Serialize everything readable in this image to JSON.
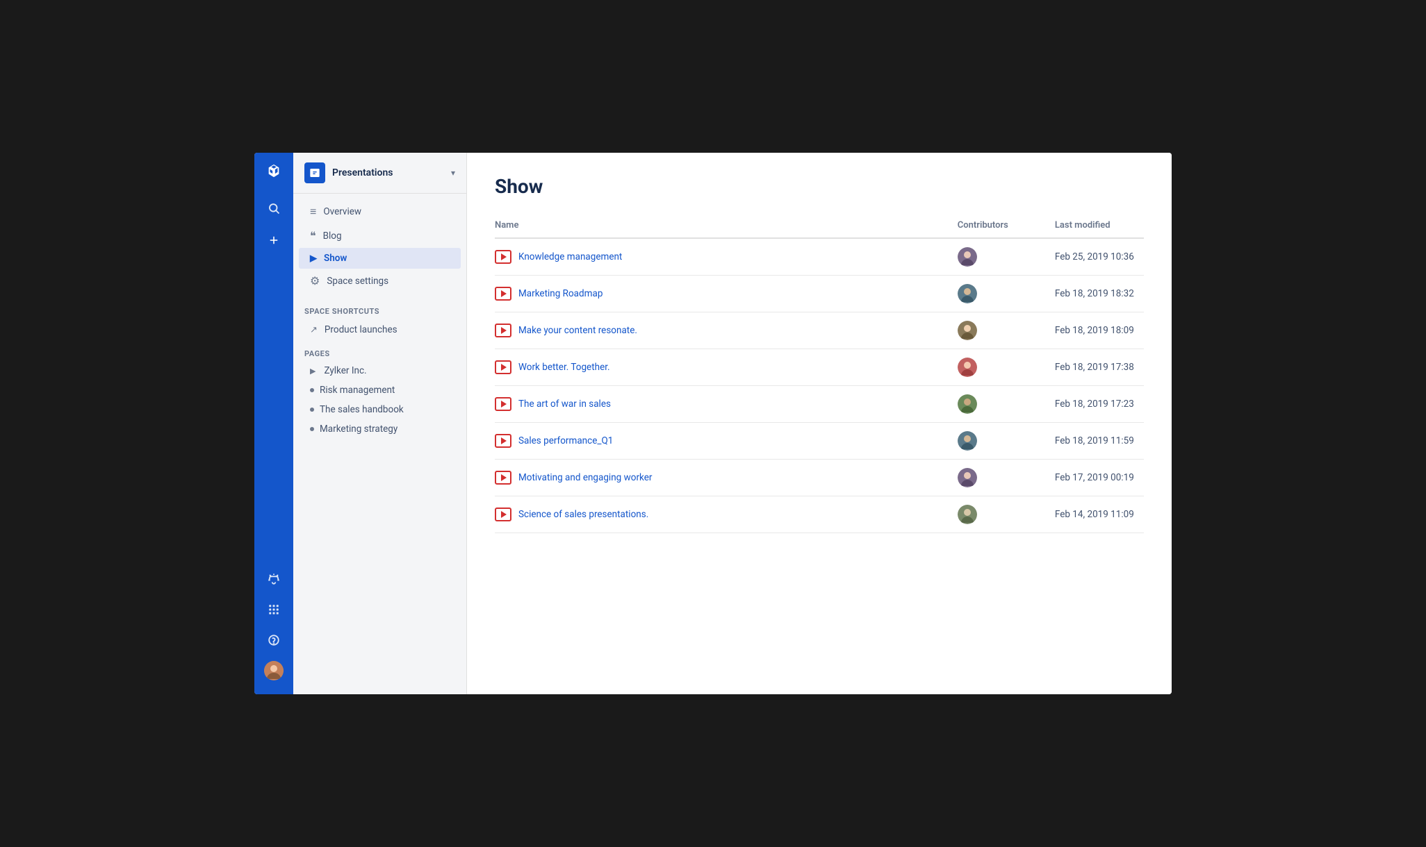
{
  "app": {
    "title": "Presentations"
  },
  "globalNav": {
    "logo_icon": "✕",
    "search_label": "Search",
    "create_label": "Create",
    "notifications_label": "Notifications",
    "apps_label": "Apps",
    "help_label": "Help"
  },
  "sidebar": {
    "space_name": "Presentations",
    "nav_items": [
      {
        "id": "overview",
        "label": "Overview",
        "icon": "≡",
        "active": false
      },
      {
        "id": "blog",
        "label": "Blog",
        "icon": "❝",
        "active": false
      },
      {
        "id": "show",
        "label": "Show",
        "icon": "▷",
        "active": true
      },
      {
        "id": "space-settings",
        "label": "Space settings",
        "icon": "⚙",
        "active": false
      }
    ],
    "shortcuts_label": "SPACE SHORTCUTS",
    "shortcuts": [
      {
        "id": "product-launches",
        "label": "Product launches"
      }
    ],
    "pages_label": "PAGES",
    "pages": [
      {
        "id": "zylker-inc",
        "label": "Zylker Inc.",
        "has_children": true
      },
      {
        "id": "risk-management",
        "label": "Risk management"
      },
      {
        "id": "sales-handbook",
        "label": "The sales handbook"
      },
      {
        "id": "marketing-strategy",
        "label": "Marketing strategy"
      }
    ]
  },
  "main": {
    "page_title": "Show",
    "table": {
      "columns": [
        {
          "id": "name",
          "label": "Name"
        },
        {
          "id": "contributors",
          "label": "Contributors"
        },
        {
          "id": "last_modified",
          "label": "Last modified"
        }
      ],
      "rows": [
        {
          "id": 1,
          "name": "Knowledge management",
          "last_modified": "Feb 25, 2019 10:36",
          "avatar_color": "#7a6a8a"
        },
        {
          "id": 2,
          "name": "Marketing Roadmap",
          "last_modified": "Feb 18, 2019 18:32",
          "avatar_color": "#5a7a8a"
        },
        {
          "id": 3,
          "name": "Make your content resonate.",
          "last_modified": "Feb 18, 2019 18:09",
          "avatar_color": "#8a7a5a"
        },
        {
          "id": 4,
          "name": "Work better. Together.",
          "last_modified": "Feb 18, 2019 17:38",
          "avatar_color": "#c26060"
        },
        {
          "id": 5,
          "name": "The art of war in sales",
          "last_modified": "Feb 18, 2019 17:23",
          "avatar_color": "#7a8a6a"
        },
        {
          "id": 6,
          "name": "Sales performance_Q1",
          "last_modified": "Feb 18, 2019 11:59",
          "avatar_color": "#5a7a8a"
        },
        {
          "id": 7,
          "name": "Motivating and engaging worker",
          "last_modified": "Feb 17, 2019 00:19",
          "avatar_color": "#7a6a8a"
        },
        {
          "id": 8,
          "name": "Science of sales presentations.",
          "last_modified": "Feb 14, 2019 11:09",
          "avatar_color": "#7a8a6a"
        }
      ]
    }
  }
}
